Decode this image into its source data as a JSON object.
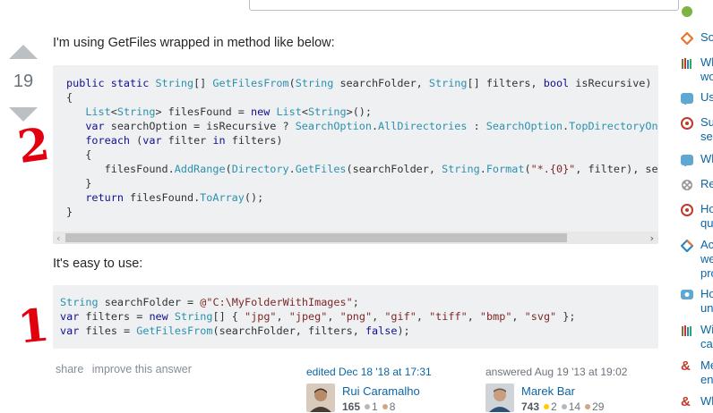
{
  "vote": {
    "score": "19"
  },
  "intro_text": "I'm using GetFiles wrapped in method like below:",
  "code1": {
    "lines": [
      [
        [
          "kw",
          "public static "
        ],
        [
          "ty",
          "String"
        ],
        [
          "",
          "[] "
        ],
        [
          "ty",
          "GetFilesFrom"
        ],
        [
          "",
          "("
        ],
        [
          "ty",
          "String"
        ],
        [
          "",
          " searchFolder, "
        ],
        [
          "ty",
          "String"
        ],
        [
          "",
          "[] filters, "
        ],
        [
          "kw",
          "bool"
        ],
        [
          "",
          " isRecursive)"
        ]
      ],
      [
        [
          "",
          "{"
        ]
      ],
      [
        [
          "",
          "   "
        ],
        [
          "ty",
          "List"
        ],
        [
          "",
          "<"
        ],
        [
          "ty",
          "String"
        ],
        [
          "",
          "> filesFound = "
        ],
        [
          "kw",
          "new "
        ],
        [
          "ty",
          "List"
        ],
        [
          "",
          "<"
        ],
        [
          "ty",
          "String"
        ],
        [
          "",
          ">();"
        ]
      ],
      [
        [
          "",
          "   "
        ],
        [
          "kw",
          "var"
        ],
        [
          "",
          " searchOption = isRecursive ? "
        ],
        [
          "ty",
          "SearchOption"
        ],
        [
          "",
          "."
        ],
        [
          "ty",
          "AllDirectories"
        ],
        [
          "",
          " : "
        ],
        [
          "ty",
          "SearchOption"
        ],
        [
          "",
          "."
        ],
        [
          "ty",
          "TopDirectoryOnly"
        ],
        [
          "",
          ";"
        ]
      ],
      [
        [
          "",
          "   "
        ],
        [
          "kw",
          "foreach"
        ],
        [
          "",
          " ("
        ],
        [
          "kw",
          "var"
        ],
        [
          "",
          " filter "
        ],
        [
          "kw",
          "in"
        ],
        [
          "",
          " filters)"
        ]
      ],
      [
        [
          "",
          "   {"
        ]
      ],
      [
        [
          "",
          "      filesFound."
        ],
        [
          "ty",
          "AddRange"
        ],
        [
          "",
          "("
        ],
        [
          "ty",
          "Directory"
        ],
        [
          "",
          "."
        ],
        [
          "ty",
          "GetFiles"
        ],
        [
          "",
          "(searchFolder, "
        ],
        [
          "ty",
          "String"
        ],
        [
          "",
          "."
        ],
        [
          "ty",
          "Format"
        ],
        [
          "",
          "("
        ],
        [
          "st",
          "\"*.{0}\""
        ],
        [
          "",
          ", filter), searchOption));"
        ]
      ],
      [
        [
          "",
          "   }"
        ]
      ],
      [
        [
          "",
          "   "
        ],
        [
          "kw",
          "return"
        ],
        [
          "",
          " filesFound."
        ],
        [
          "ty",
          "ToArray"
        ],
        [
          "",
          "();"
        ]
      ],
      [
        [
          "",
          "}"
        ]
      ]
    ]
  },
  "easy_text": "It's easy to use:",
  "code2": {
    "lines": [
      [
        [
          "ty",
          "String"
        ],
        [
          "",
          " searchFolder = "
        ],
        [
          "st",
          "@\"C:\\MyFolderWithImages\""
        ],
        [
          "",
          ";"
        ]
      ],
      [
        [
          "kw",
          "var"
        ],
        [
          "",
          " filters = "
        ],
        [
          "kw",
          "new "
        ],
        [
          "ty",
          "String"
        ],
        [
          "",
          "[] { "
        ],
        [
          "st",
          "\"jpg\""
        ],
        [
          "",
          ", "
        ],
        [
          "st",
          "\"jpeg\""
        ],
        [
          "",
          ", "
        ],
        [
          "st",
          "\"png\""
        ],
        [
          "",
          ", "
        ],
        [
          "st",
          "\"gif\""
        ],
        [
          "",
          ", "
        ],
        [
          "st",
          "\"tiff\""
        ],
        [
          "",
          ", "
        ],
        [
          "st",
          "\"bmp\""
        ],
        [
          "",
          ", "
        ],
        [
          "st",
          "\"svg\""
        ],
        [
          "",
          " };"
        ]
      ],
      [
        [
          "kw",
          "var"
        ],
        [
          "",
          " files = "
        ],
        [
          "ty",
          "GetFilesFrom"
        ],
        [
          "",
          "(searchFolder, filters, "
        ],
        [
          "kw",
          "false"
        ],
        [
          "",
          ");"
        ]
      ]
    ]
  },
  "post_menu": {
    "share": "share",
    "improve": "improve this answer"
  },
  "editor": {
    "action": "edited Dec 18 '18 at 17:31",
    "name": "Rui Caramalho",
    "rep": "165",
    "silver": "1",
    "bronze": "8"
  },
  "answerer": {
    "action": "answered Aug 19 '13 at 19:02",
    "name": "Marek Bar",
    "rep": "743",
    "gold": "2",
    "silver": "14",
    "bronze": "29"
  },
  "sidebar": [
    {
      "icon": "green-circle-icon",
      "text": ""
    },
    {
      "icon": "diamond-icon",
      "text": "So"
    },
    {
      "icon": "books-icon",
      "text": "Wh\nwo"
    },
    {
      "icon": "lo-badge-icon",
      "text": "Us"
    },
    {
      "icon": "ubuntu-icon",
      "text": "Su\nser"
    },
    {
      "icon": "rc-badge-icon",
      "text": "Wh"
    },
    {
      "icon": "reel-icon",
      "text": "Re"
    },
    {
      "icon": "question-circle-icon",
      "text": "Ho\nqui"
    },
    {
      "icon": "diamond-icon",
      "text": "Acc\nwe\npro"
    },
    {
      "icon": "chat-icon",
      "text": "Ho\nuni"
    },
    {
      "icon": "books-icon",
      "text": "Wil\ncar"
    },
    {
      "icon": "ampersand-icon",
      "text": "Me\nen"
    },
    {
      "icon": "ampersand-icon",
      "text": "Wh"
    }
  ],
  "annotations": {
    "mark_1": "1",
    "mark_2": "2"
  },
  "colors": {
    "link": "#0c65a5",
    "code_bg": "#eff0f1",
    "keyword": "#101094",
    "type": "#2b91af",
    "string": "#7d2727",
    "annotation": "#e2000f"
  }
}
